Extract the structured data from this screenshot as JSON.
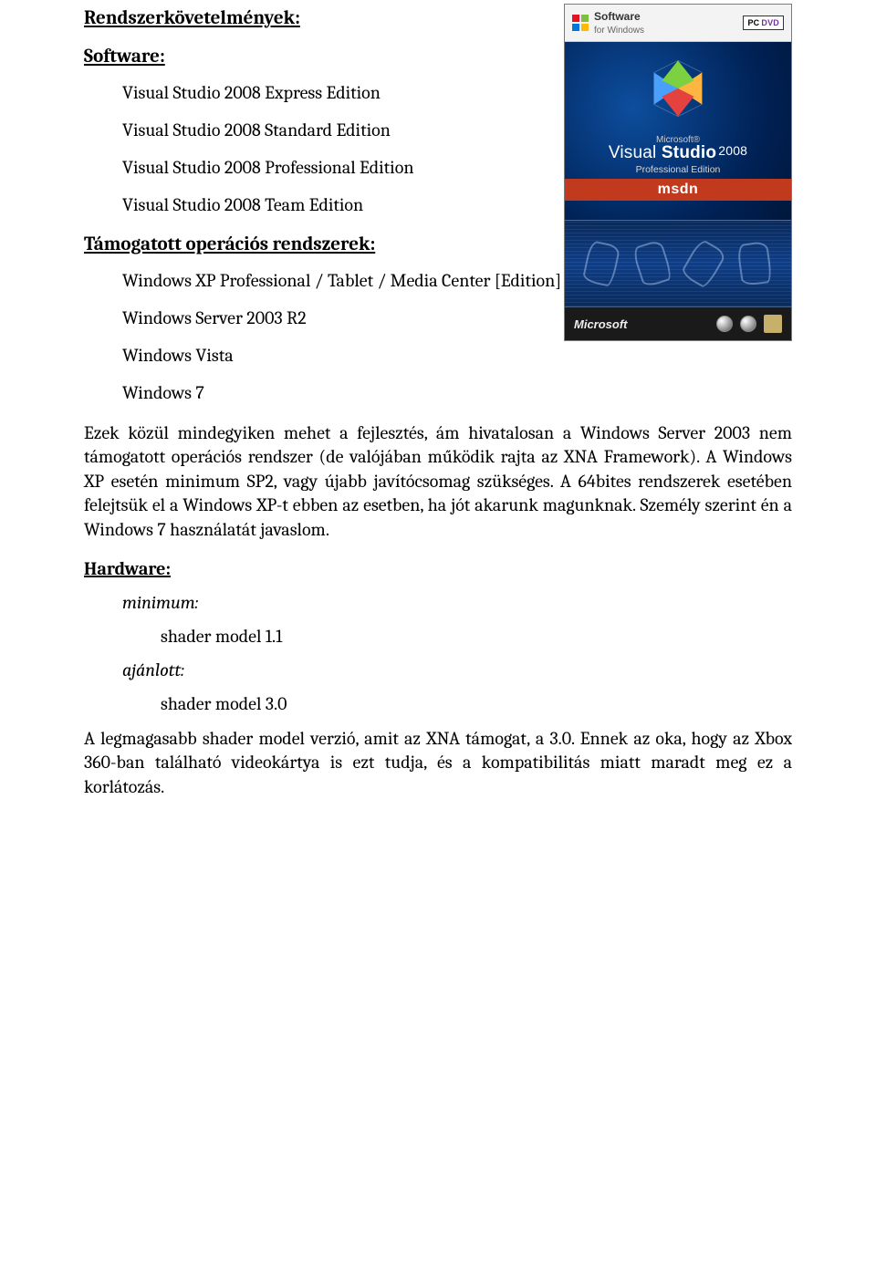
{
  "headings": {
    "requirements": "Rendszerkövetelmények:",
    "software": "Software:",
    "supported_os": "Támogatott operációs rendszerek:",
    "hardware": "Hardware:"
  },
  "software_list": [
    "Visual Studio 2008 Express Edition",
    "Visual Studio 2008 Standard Edition",
    "Visual Studio 2008 Professional Edition",
    "Visual Studio 2008 Team Edition"
  ],
  "os_list": [
    "Windows XP Professional / Tablet / Media Center  [Edition]",
    "Windows Server 2003 R2",
    "Windows Vista",
    "Windows 7"
  ],
  "os_paragraph": "Ezek közül mindegyiken mehet a fejlesztés, ám hivatalosan a Windows Server 2003 nem támogatott operációs rendszer (de valójában működik rajta az XNA Framework). A Windows XP esetén minimum SP2, vagy újabb javítócsomag szükséges. A 64bites rendszerek esetében felejtsük el a Windows XP-t ebben az esetben, ha jót akarunk magunknak. Személy szerint én a Windows 7 használatát javaslom.",
  "hardware": {
    "minimum_label": "minimum:",
    "minimum_value": "shader model 1.1",
    "recommended_label": "ajánlott:",
    "recommended_value": "shader model 3.0"
  },
  "shader_paragraph": "A legmagasabb shader model verzió, amit az XNA támogat, a 3.0. Ennek az oka, hogy az Xbox 360-ban található videokártya is ezt tudja, és a kompatibilitás miatt maradt meg ez a korlátozás.",
  "boxart": {
    "topbar_left_brand": "Software",
    "topbar_left_sub": "for Windows",
    "topbar_right": "PC DVD",
    "microsoft_small": "Microsoft®",
    "product_name_prefix": "Visual",
    "product_name_bold": "Studio",
    "product_year": "2008",
    "edition_line": "Professional Edition",
    "msdn": "msdn",
    "footer_brand": "Microsoft"
  }
}
